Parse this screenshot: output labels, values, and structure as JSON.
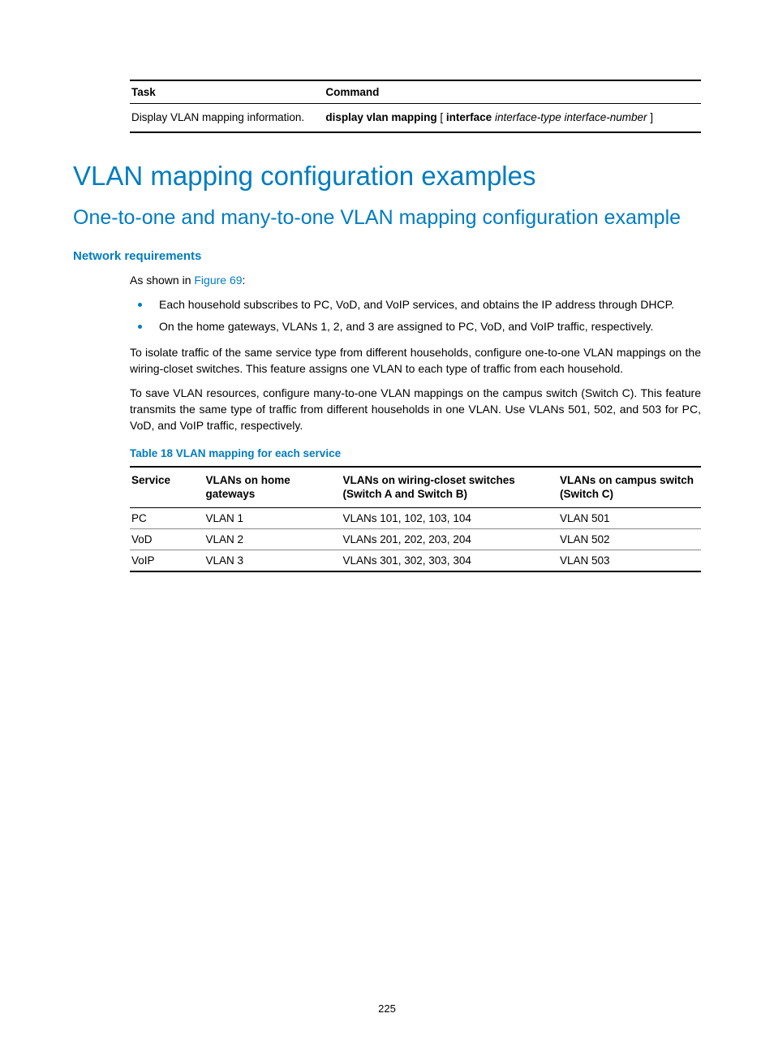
{
  "task_table": {
    "headers": [
      "Task",
      "Command"
    ],
    "row": {
      "task": "Display VLAN mapping information.",
      "command_parts": {
        "p1_bold": "display vlan mapping",
        "p2_plain": " [ ",
        "p3_bold": "interface",
        "p4_plain": " ",
        "p5_italic": "interface-type interface-number",
        "p6_plain": " ]"
      }
    }
  },
  "headings": {
    "h1": "VLAN mapping configuration examples",
    "h2": "One-to-one and many-to-one VLAN mapping configuration example",
    "h3": "Network requirements"
  },
  "intro": {
    "prefix": "As shown in ",
    "link": "Figure 69",
    "suffix": ":"
  },
  "bullets": [
    "Each household subscribes to PC, VoD, and VoIP services, and obtains the IP address through DHCP.",
    "On the home gateways, VLANs 1, 2, and 3 are assigned to PC, VoD, and VoIP traffic, respectively."
  ],
  "paragraphs": [
    "To isolate traffic of the same service type from different households, configure one-to-one VLAN mappings on the wiring-closet switches. This feature assigns one VLAN to each type of traffic from each household.",
    "To save VLAN resources, configure many-to-one VLAN mappings on the campus switch (Switch C). This feature transmits the same type of traffic from different households in one VLAN. Use VLANs 501, 502, and 503 for PC, VoD, and VoIP traffic, respectively."
  ],
  "table_caption": "Table 18 VLAN mapping for each service",
  "vlan_table": {
    "headers": [
      "Service",
      "VLANs on home gateways",
      "VLANs on wiring-closet switches (Switch A and Switch B)",
      "VLANs on campus switch (Switch C)"
    ],
    "rows": [
      {
        "service": "PC",
        "home": "VLAN 1",
        "closet": "VLANs 101, 102, 103, 104",
        "campus": "VLAN 501"
      },
      {
        "service": "VoD",
        "home": "VLAN 2",
        "closet": "VLANs 201, 202, 203, 204",
        "campus": "VLAN 502"
      },
      {
        "service": "VoIP",
        "home": "VLAN 3",
        "closet": "VLANs 301, 302, 303, 304",
        "campus": "VLAN 503"
      }
    ]
  },
  "page_number": "225"
}
